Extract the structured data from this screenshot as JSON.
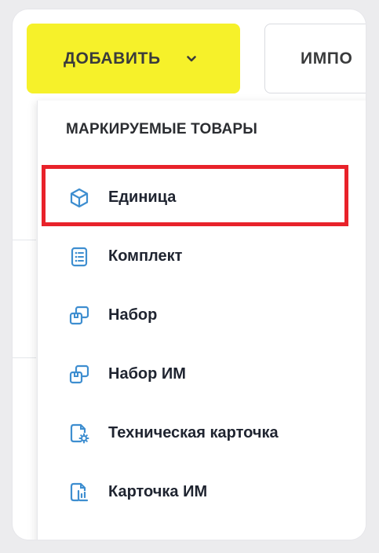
{
  "toolbar": {
    "add_label": "ДОБАВИТЬ",
    "import_label": "ИМПО"
  },
  "dropdown": {
    "header": "МАРКИРУЕМЫЕ ТОВАРЫ",
    "items": [
      {
        "label": "Единица",
        "icon": "cube-icon"
      },
      {
        "label": "Комплект",
        "icon": "list-document-icon"
      },
      {
        "label": "Набор",
        "icon": "boxes-icon"
      },
      {
        "label": "Набор ИМ",
        "icon": "boxes-icon"
      },
      {
        "label": "Техническая карточка",
        "icon": "document-gear-icon"
      },
      {
        "label": "Карточка ИМ",
        "icon": "document-chart-icon"
      }
    ],
    "highlighted_index": 0
  },
  "colors": {
    "accent_yellow": "#f6f12a",
    "icon_blue": "#3e8ed0",
    "highlight_red": "#e8222a"
  }
}
